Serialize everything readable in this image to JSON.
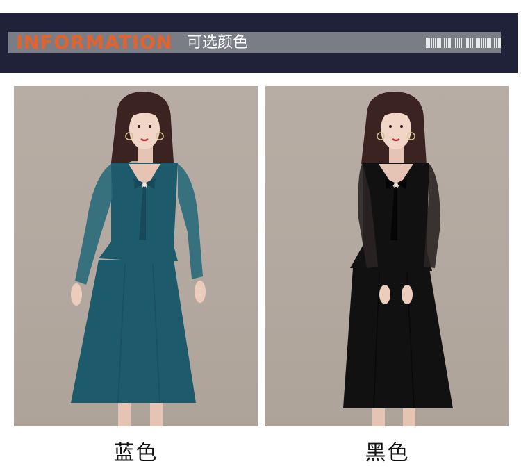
{
  "header": {
    "title": "INFORMATION",
    "subtitle": "可选颜色"
  },
  "products": [
    {
      "caption": "蓝色",
      "dress_color": "#1d5a6c",
      "dress_dark": "#17495a",
      "sleeve_color": "#2a6a7a"
    },
    {
      "caption": "黑色",
      "dress_color": "#111111",
      "dress_dark": "#050505",
      "sleeve_color": "#2a2523"
    }
  ],
  "colors": {
    "banner_background": "#1f2238",
    "banner_bar": "#7a7d85",
    "title_accent": "#e4632c",
    "photo_background": "#b2a89f"
  }
}
